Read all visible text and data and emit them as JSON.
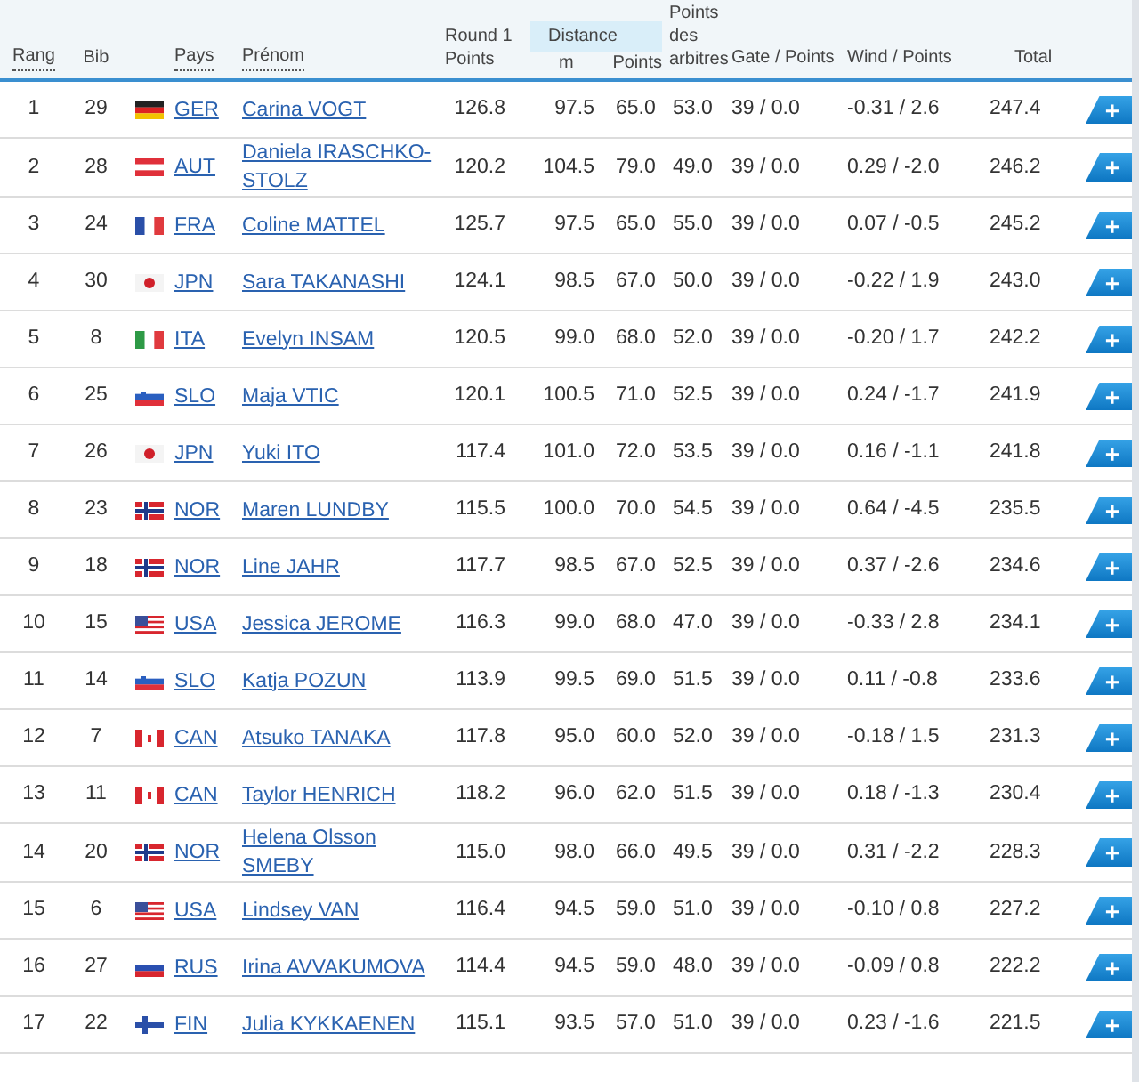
{
  "header": {
    "rank": "Rang",
    "bib": "Bib",
    "country": "Pays",
    "name": "Prénom",
    "round1": "Round 1 Points",
    "distance": {
      "label": "Distance",
      "m": "m",
      "points": "Points"
    },
    "judges": "Points des arbitres",
    "gate": "Gate / Points",
    "wind": "Wind / Points",
    "total": "Total"
  },
  "rows": [
    {
      "rank": "1",
      "bib": "29",
      "flag": {
        "kind": "de"
      },
      "country": "GER",
      "name": "Carina VOGT",
      "round1": "126.8",
      "distance_m": "97.5",
      "distance_points": "65.0",
      "judges": "53.0",
      "gate": "39 / 0.0",
      "wind": "-0.31 / 2.6",
      "total": "247.4",
      "button": "+"
    },
    {
      "rank": "2",
      "bib": "28",
      "flag": {
        "kind": "at"
      },
      "country": "AUT",
      "name": "Daniela IRASCHKO-STOLZ",
      "round1": "120.2",
      "distance_m": "104.5",
      "distance_points": "79.0",
      "judges": "49.0",
      "gate": "39 / 0.0",
      "wind": "0.29 / -2.0",
      "total": "246.2",
      "button": "+"
    },
    {
      "rank": "3",
      "bib": "24",
      "flag": {
        "kind": "fr"
      },
      "country": "FRA",
      "name": "Coline MATTEL",
      "round1": "125.7",
      "distance_m": "97.5",
      "distance_points": "65.0",
      "judges": "55.0",
      "gate": "39 / 0.0",
      "wind": "0.07 / -0.5",
      "total": "245.2",
      "button": "+"
    },
    {
      "rank": "4",
      "bib": "30",
      "flag": {
        "kind": "jp"
      },
      "country": "JPN",
      "name": "Sara TAKANASHI",
      "round1": "124.1",
      "distance_m": "98.5",
      "distance_points": "67.0",
      "judges": "50.0",
      "gate": "39 / 0.0",
      "wind": "-0.22 / 1.9",
      "total": "243.0",
      "button": "+"
    },
    {
      "rank": "5",
      "bib": "8",
      "flag": {
        "kind": "it"
      },
      "country": "ITA",
      "name": "Evelyn INSAM",
      "round1": "120.5",
      "distance_m": "99.0",
      "distance_points": "68.0",
      "judges": "52.0",
      "gate": "39 / 0.0",
      "wind": "-0.20 / 1.7",
      "total": "242.2",
      "button": "+"
    },
    {
      "rank": "6",
      "bib": "25",
      "flag": {
        "kind": "si"
      },
      "country": "SLO",
      "name": "Maja VTIC",
      "round1": "120.1",
      "distance_m": "100.5",
      "distance_points": "71.0",
      "judges": "52.5",
      "gate": "39 / 0.0",
      "wind": "0.24 / -1.7",
      "total": "241.9",
      "button": "+"
    },
    {
      "rank": "7",
      "bib": "26",
      "flag": {
        "kind": "jp"
      },
      "country": "JPN",
      "name": "Yuki ITO",
      "round1": "117.4",
      "distance_m": "101.0",
      "distance_points": "72.0",
      "judges": "53.5",
      "gate": "39 / 0.0",
      "wind": "0.16 / -1.1",
      "total": "241.8",
      "button": "+"
    },
    {
      "rank": "8",
      "bib": "23",
      "flag": {
        "kind": "no"
      },
      "country": "NOR",
      "name": "Maren LUNDBY",
      "round1": "115.5",
      "distance_m": "100.0",
      "distance_points": "70.0",
      "judges": "54.5",
      "gate": "39 / 0.0",
      "wind": "0.64 / -4.5",
      "total": "235.5",
      "button": "+"
    },
    {
      "rank": "9",
      "bib": "18",
      "flag": {
        "kind": "no"
      },
      "country": "NOR",
      "name": "Line JAHR",
      "round1": "117.7",
      "distance_m": "98.5",
      "distance_points": "67.0",
      "judges": "52.5",
      "gate": "39 / 0.0",
      "wind": "0.37 / -2.6",
      "total": "234.6",
      "button": "+"
    },
    {
      "rank": "10",
      "bib": "15",
      "flag": {
        "kind": "us"
      },
      "country": "USA",
      "name": "Jessica JEROME",
      "round1": "116.3",
      "distance_m": "99.0",
      "distance_points": "68.0",
      "judges": "47.0",
      "gate": "39 / 0.0",
      "wind": "-0.33 / 2.8",
      "total": "234.1",
      "button": "+"
    },
    {
      "rank": "11",
      "bib": "14",
      "flag": {
        "kind": "si"
      },
      "country": "SLO",
      "name": "Katja POZUN",
      "round1": "113.9",
      "distance_m": "99.5",
      "distance_points": "69.0",
      "judges": "51.5",
      "gate": "39 / 0.0",
      "wind": "0.11 / -0.8",
      "total": "233.6",
      "button": "+"
    },
    {
      "rank": "12",
      "bib": "7",
      "flag": {
        "kind": "ca"
      },
      "country": "CAN",
      "name": "Atsuko TANAKA",
      "round1": "117.8",
      "distance_m": "95.0",
      "distance_points": "60.0",
      "judges": "52.0",
      "gate": "39 / 0.0",
      "wind": "-0.18 / 1.5",
      "total": "231.3",
      "button": "+"
    },
    {
      "rank": "13",
      "bib": "11",
      "flag": {
        "kind": "ca"
      },
      "country": "CAN",
      "name": "Taylor HENRICH",
      "round1": "118.2",
      "distance_m": "96.0",
      "distance_points": "62.0",
      "judges": "51.5",
      "gate": "39 / 0.0",
      "wind": "0.18 / -1.3",
      "total": "230.4",
      "button": "+"
    },
    {
      "rank": "14",
      "bib": "20",
      "flag": {
        "kind": "no"
      },
      "country": "NOR",
      "name": "Helena Olsson SMEBY",
      "round1": "115.0",
      "distance_m": "98.0",
      "distance_points": "66.0",
      "judges": "49.5",
      "gate": "39 / 0.0",
      "wind": "0.31 / -2.2",
      "total": "228.3",
      "button": "+"
    },
    {
      "rank": "15",
      "bib": "6",
      "flag": {
        "kind": "us"
      },
      "country": "USA",
      "name": "Lindsey VAN",
      "round1": "116.4",
      "distance_m": "94.5",
      "distance_points": "59.0",
      "judges": "51.0",
      "gate": "39 / 0.0",
      "wind": "-0.10 / 0.8",
      "total": "227.2",
      "button": "+"
    },
    {
      "rank": "16",
      "bib": "27",
      "flag": {
        "kind": "ru"
      },
      "country": "RUS",
      "name": "Irina AVVAKUMOVA",
      "round1": "114.4",
      "distance_m": "94.5",
      "distance_points": "59.0",
      "judges": "48.0",
      "gate": "39 / 0.0",
      "wind": "-0.09 / 0.8",
      "total": "222.2",
      "button": "+"
    },
    {
      "rank": "17",
      "bib": "22",
      "flag": {
        "kind": "fi"
      },
      "country": "FIN",
      "name": "Julia KYKKAENEN",
      "round1": "115.1",
      "distance_m": "93.5",
      "distance_points": "57.0",
      "judges": "51.0",
      "gate": "39 / 0.0",
      "wind": "0.23 / -1.6",
      "total": "221.5",
      "button": "+"
    }
  ]
}
